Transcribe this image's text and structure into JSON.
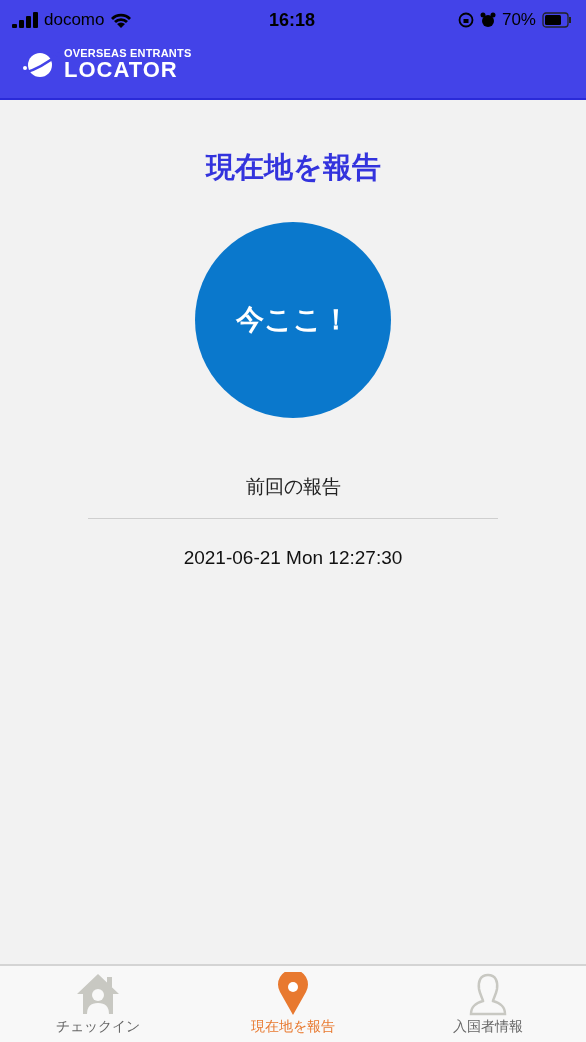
{
  "status_bar": {
    "carrier": "docomo",
    "time": "16:18",
    "battery_percent": "70%"
  },
  "header": {
    "logo_top": "OVERSEAS ENTRANTS",
    "logo_bottom": "LOCATOR"
  },
  "title": "現在地を報告",
  "report_button": "今ここ！",
  "last_report": {
    "label": "前回の報告",
    "value": "2021-06-21 Mon 12:27:30"
  },
  "tabs": [
    {
      "kind": "house",
      "label": "チェックイン",
      "selected": false
    },
    {
      "kind": "pin",
      "label": "現在地を報告",
      "selected": true
    },
    {
      "kind": "person",
      "label": "入国者情報",
      "selected": false
    }
  ]
}
